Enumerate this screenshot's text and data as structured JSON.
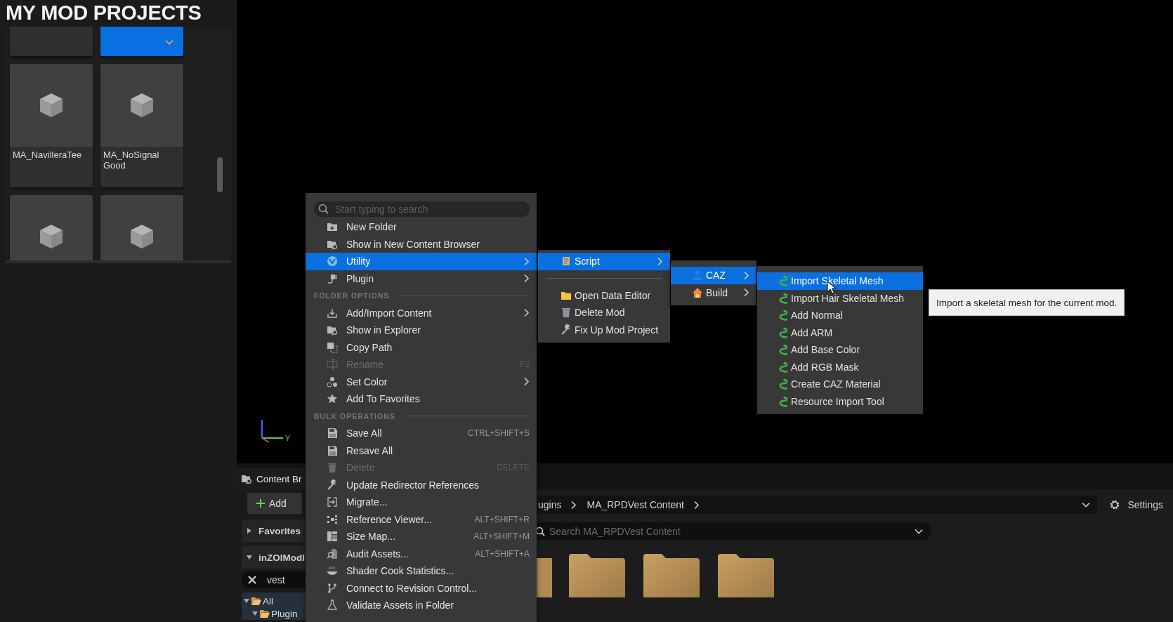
{
  "overlay_title": "MY MOD PROJECTS",
  "asset_grid": {
    "cards": [
      {
        "kind": "stub",
        "selected": false
      },
      {
        "kind": "stub",
        "selected": true
      },
      {
        "kind": "asset",
        "label": "MA_NavilleraTee",
        "selected": false
      },
      {
        "kind": "asset",
        "label": "MA_NoSignal Good",
        "selected": false
      },
      {
        "kind": "asset",
        "selected": false
      },
      {
        "kind": "asset",
        "selected": false
      }
    ]
  },
  "viewport": {
    "axis_label": "Y"
  },
  "content_browser": {
    "tab": {
      "label": "Content Br",
      "selected": true
    },
    "add_button": "Add",
    "sections": [
      {
        "label": "Favorites",
        "expanded": false
      },
      {
        "label": "inZOIModl",
        "expanded": true
      }
    ],
    "filter": {
      "value": "vest"
    },
    "tree": [
      {
        "label": "All",
        "expanded": true,
        "children": [
          {
            "label": "Plugin",
            "expanded": true
          }
        ]
      }
    ],
    "path": [
      "ugins",
      "MA_RPDVest Content"
    ],
    "settings_button": "Settings",
    "search": {
      "placeholder": "Search MA_RPDVest Content"
    },
    "folders": [
      {
        "kind": "partial"
      },
      {
        "kind": "folder"
      },
      {
        "kind": "folder"
      },
      {
        "kind": "folder"
      }
    ]
  },
  "context_menu": {
    "search": {
      "placeholder": "Start typing to search"
    },
    "entries": [
      {
        "kind": "item",
        "label": "New Folder",
        "selected": false,
        "disabled": false,
        "has_submenu": false
      },
      {
        "kind": "item",
        "label": "Show in New Content Browser",
        "selected": false,
        "disabled": false,
        "has_submenu": false
      },
      {
        "kind": "item",
        "label": "Utility",
        "selected": true,
        "disabled": false,
        "has_submenu": true
      },
      {
        "kind": "item",
        "label": "Plugin",
        "selected": false,
        "disabled": false,
        "has_submenu": true
      },
      {
        "kind": "section",
        "label": "FOLDER OPTIONS"
      },
      {
        "kind": "item",
        "label": "Add/Import Content",
        "selected": false,
        "disabled": false,
        "has_submenu": true
      },
      {
        "kind": "item",
        "label": "Show in Explorer",
        "selected": false,
        "disabled": false,
        "has_submenu": false
      },
      {
        "kind": "item",
        "label": "Copy Path",
        "selected": false,
        "disabled": false,
        "has_submenu": false
      },
      {
        "kind": "item",
        "label": "Rename",
        "shortcut": "F2",
        "selected": false,
        "disabled": true,
        "has_submenu": false
      },
      {
        "kind": "item",
        "label": "Set Color",
        "selected": false,
        "disabled": false,
        "has_submenu": true
      },
      {
        "kind": "item",
        "label": "Add To Favorites",
        "selected": false,
        "disabled": false,
        "has_submenu": false
      },
      {
        "kind": "section",
        "label": "BULK OPERATIONS"
      },
      {
        "kind": "item",
        "label": "Save All",
        "shortcut": "CTRL+SHIFT+S",
        "selected": false,
        "disabled": false,
        "has_submenu": false
      },
      {
        "kind": "item",
        "label": "Resave All",
        "selected": false,
        "disabled": false,
        "has_submenu": false
      },
      {
        "kind": "item",
        "label": "Delete",
        "shortcut": "DELETE",
        "selected": false,
        "disabled": true,
        "has_submenu": false
      },
      {
        "kind": "item",
        "label": "Update Redirector References",
        "selected": false,
        "disabled": false,
        "has_submenu": false
      },
      {
        "kind": "item",
        "label": "Migrate...",
        "selected": false,
        "disabled": false,
        "has_submenu": false
      },
      {
        "kind": "item",
        "label": "Reference Viewer...",
        "shortcut": "ALT+SHIFT+R",
        "selected": false,
        "disabled": false,
        "has_submenu": false
      },
      {
        "kind": "item",
        "label": "Size Map...",
        "shortcut": "ALT+SHIFT+M",
        "selected": false,
        "disabled": false,
        "has_submenu": false
      },
      {
        "kind": "item",
        "label": "Audit Assets...",
        "shortcut": "ALT+SHIFT+A",
        "selected": false,
        "disabled": false,
        "has_submenu": false
      },
      {
        "kind": "item",
        "label": "Shader Cook Statistics...",
        "selected": false,
        "disabled": false,
        "has_submenu": false
      },
      {
        "kind": "item",
        "label": "Connect to Revision Control...",
        "selected": false,
        "disabled": false,
        "has_submenu": false
      },
      {
        "kind": "item",
        "label": "Validate Assets in Folder",
        "selected": false,
        "disabled": false,
        "has_submenu": false
      }
    ]
  },
  "script_menu": {
    "entries": [
      {
        "kind": "item",
        "label": "Script",
        "selected": true,
        "disabled": false,
        "has_submenu": true
      },
      {
        "kind": "divider"
      },
      {
        "kind": "item",
        "label": "Open Data Editor",
        "selected": false,
        "disabled": false,
        "has_submenu": false
      },
      {
        "kind": "item",
        "label": "Delete Mod",
        "selected": false,
        "disabled": false,
        "has_submenu": false
      },
      {
        "kind": "item",
        "label": "Fix Up Mod Project",
        "selected": false,
        "disabled": false,
        "has_submenu": false
      }
    ]
  },
  "caz_menu": {
    "entries": [
      {
        "kind": "item",
        "label": "CAZ",
        "selected": true,
        "disabled": false,
        "has_submenu": true
      },
      {
        "kind": "item",
        "label": "Build",
        "selected": false,
        "disabled": false,
        "has_submenu": true
      }
    ]
  },
  "import_menu": {
    "entries": [
      {
        "kind": "item",
        "label": "Import Skeletal Mesh",
        "selected": true,
        "disabled": false,
        "has_submenu": false
      },
      {
        "kind": "item",
        "label": "Import Hair Skeletal Mesh",
        "selected": false,
        "disabled": false,
        "has_submenu": false
      },
      {
        "kind": "item",
        "label": "Add Normal",
        "selected": false,
        "disabled": false,
        "has_submenu": false
      },
      {
        "kind": "item",
        "label": "Add ARM",
        "selected": false,
        "disabled": false,
        "has_submenu": false
      },
      {
        "kind": "item",
        "label": "Add Base Color",
        "selected": false,
        "disabled": false,
        "has_submenu": false
      },
      {
        "kind": "item",
        "label": "Add RGB Mask",
        "selected": false,
        "disabled": false,
        "has_submenu": false
      },
      {
        "kind": "item",
        "label": "Create CAZ Material",
        "selected": false,
        "disabled": false,
        "has_submenu": false
      },
      {
        "kind": "item",
        "label": "Resource Import Tool",
        "selected": false,
        "disabled": false,
        "has_submenu": false
      }
    ]
  },
  "tooltip": {
    "text": "Import a skeletal mesh for the current mod."
  }
}
